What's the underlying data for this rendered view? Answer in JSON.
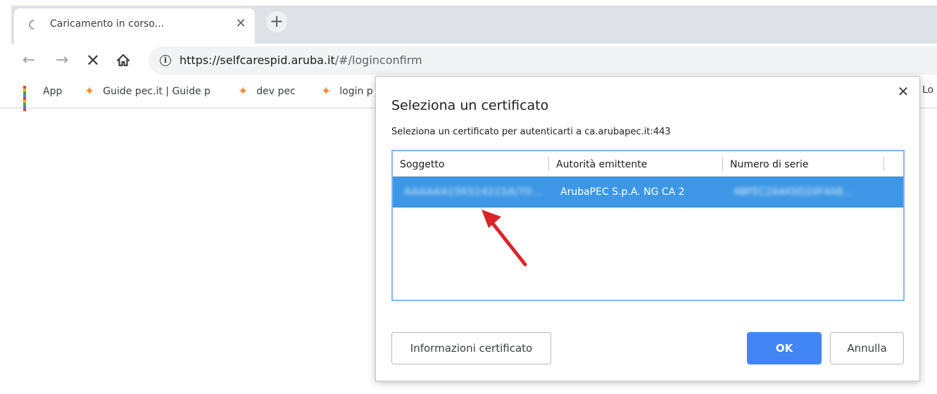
{
  "tab": {
    "title": "Caricamento in corso...",
    "close_icon": "close-icon",
    "new_tab_icon": "plus-icon"
  },
  "toolbar": {
    "url_host": "https://selfcarespid.aruba.it",
    "url_path": "/#/loginconfirm",
    "back_icon": "arrow-left-icon",
    "forward_icon": "arrow-right-icon",
    "stop_icon": "stop-icon",
    "home_icon": "home-icon",
    "site_info_icon": "info-icon"
  },
  "bookmarks": [
    {
      "label": "App",
      "icon": "apps-grid-icon"
    },
    {
      "label": "Guide pec.it | Guide p",
      "icon": "aruba-star-icon"
    },
    {
      "label": "dev pec",
      "icon": "aruba-star-icon"
    },
    {
      "label": "login p",
      "icon": "aruba-star-icon"
    }
  ],
  "bookmark_overflow": "Lo",
  "dialog": {
    "title": "Seleziona un certificato",
    "subtitle": "Seleziona un certificato per autenticarti a ca.arubapec.it:443",
    "columns": [
      "Soggetto",
      "Autorità emittente",
      "Numero di serie"
    ],
    "rows": [
      {
        "subject": "AAAAAA15KS14215A/70...",
        "issuer": "ArubaPEC S.p.A. NG CA 2",
        "serial": "4BFEC2A4A5D20F4A8..."
      }
    ],
    "buttons": {
      "info": "Informazioni certificato",
      "ok": "OK",
      "cancel": "Annulla"
    }
  },
  "colors": {
    "selection": "#3d97e6",
    "primary_button": "#4285f4",
    "annotation_arrow": "#d9252a",
    "bookmark_star": "#f28b30"
  }
}
